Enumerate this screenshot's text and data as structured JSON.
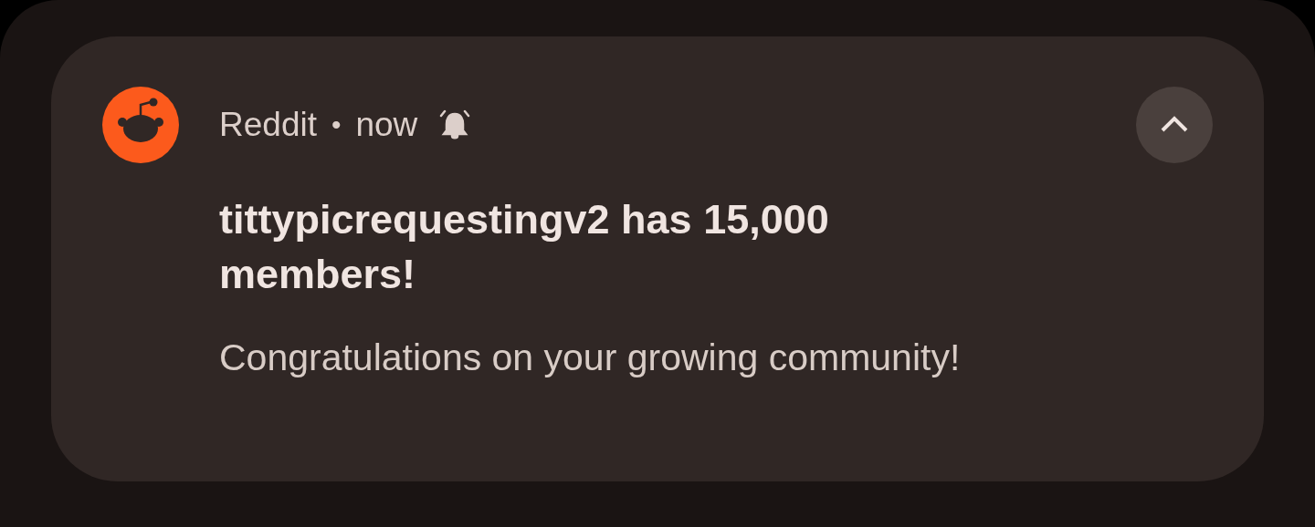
{
  "notification": {
    "app_name": "Reddit",
    "separator": "•",
    "time": "now",
    "title": "tittypicrequestingv2 has 15,000 members!",
    "body": "Congratulations on your growing community!",
    "expanded": true
  }
}
